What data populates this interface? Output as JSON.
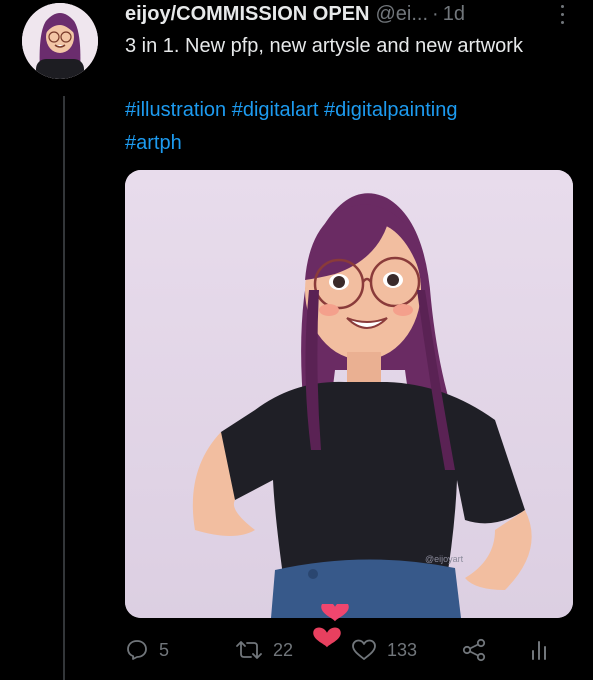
{
  "tweet": {
    "display_name": "eijoy/COMMISSION OPEN",
    "handle": "@ei...",
    "separator": "·",
    "time": "1d",
    "text": "3 in 1. New pfp, new artysle and new artwork",
    "hashtags": [
      "#illustration",
      "#digitalart",
      "#digitalpainting",
      "#artph"
    ],
    "media": {
      "watermark": "@eijoyart"
    }
  },
  "actions": {
    "reply_count": "5",
    "retweet_count": "22",
    "like_count": "133"
  },
  "colors": {
    "background": "#000000",
    "text": "#e7e9ea",
    "secondary": "#71767b",
    "link": "#1d9bf0",
    "heart_pink": "#f0466e"
  },
  "icons": [
    "more-icon",
    "reply-icon",
    "retweet-icon",
    "like-icon",
    "share-icon",
    "analytics-icon",
    "hearts-animation-icon"
  ]
}
